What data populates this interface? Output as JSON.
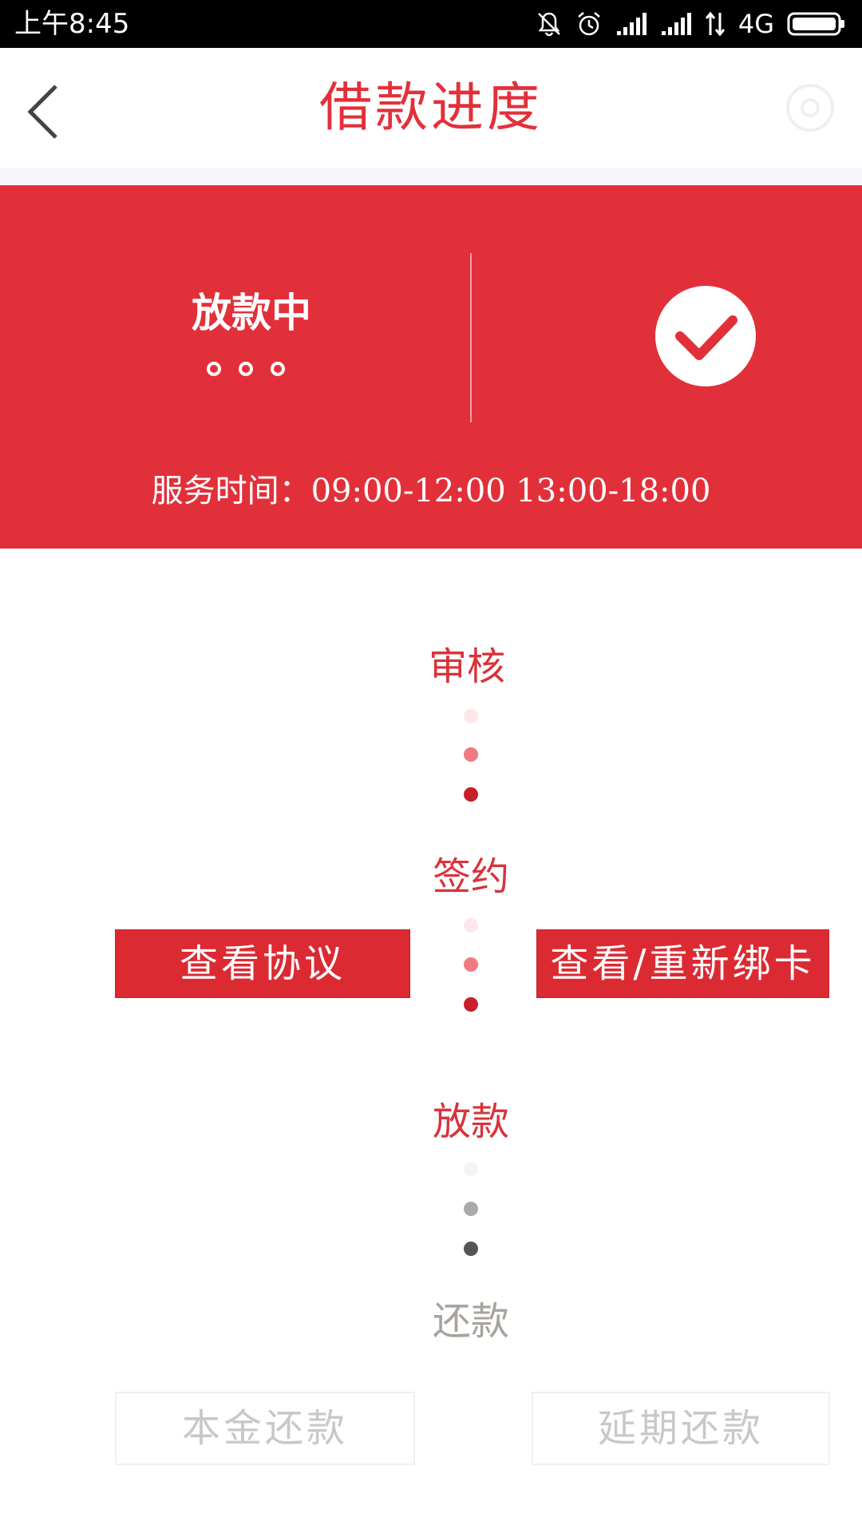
{
  "status_bar": {
    "time": "上午8:45",
    "network": "4G",
    "icons": [
      "mute-icon",
      "alarm-icon",
      "signal-icon",
      "signal-icon",
      "data-transfer-icon",
      "battery-icon"
    ]
  },
  "header": {
    "title": "借款进度",
    "back_icon": "chevron-left-icon"
  },
  "banner": {
    "status": "放款中",
    "service_hours": "服务时间：09:00-12:00 13:00-18:00",
    "check_icon": "checkmark-circle-icon",
    "colors": {
      "background": "#e2303a",
      "foreground": "#ffffff"
    }
  },
  "steps": [
    {
      "label": "审核",
      "state": "done"
    },
    {
      "label": "签约",
      "state": "done"
    },
    {
      "label": "放款",
      "state": "current"
    },
    {
      "label": "还款",
      "state": "pending"
    }
  ],
  "actions": {
    "view_agreement": "查看协议",
    "rebind_card": "查看/重新绑卡",
    "principal_repayment": "本金还款",
    "extended_repayment": "延期还款"
  },
  "colors": {
    "accent": "#e2303a",
    "step_done": "#d8333b",
    "step_pending": "#a8a39d",
    "disabled_text": "#c8c8c8"
  }
}
